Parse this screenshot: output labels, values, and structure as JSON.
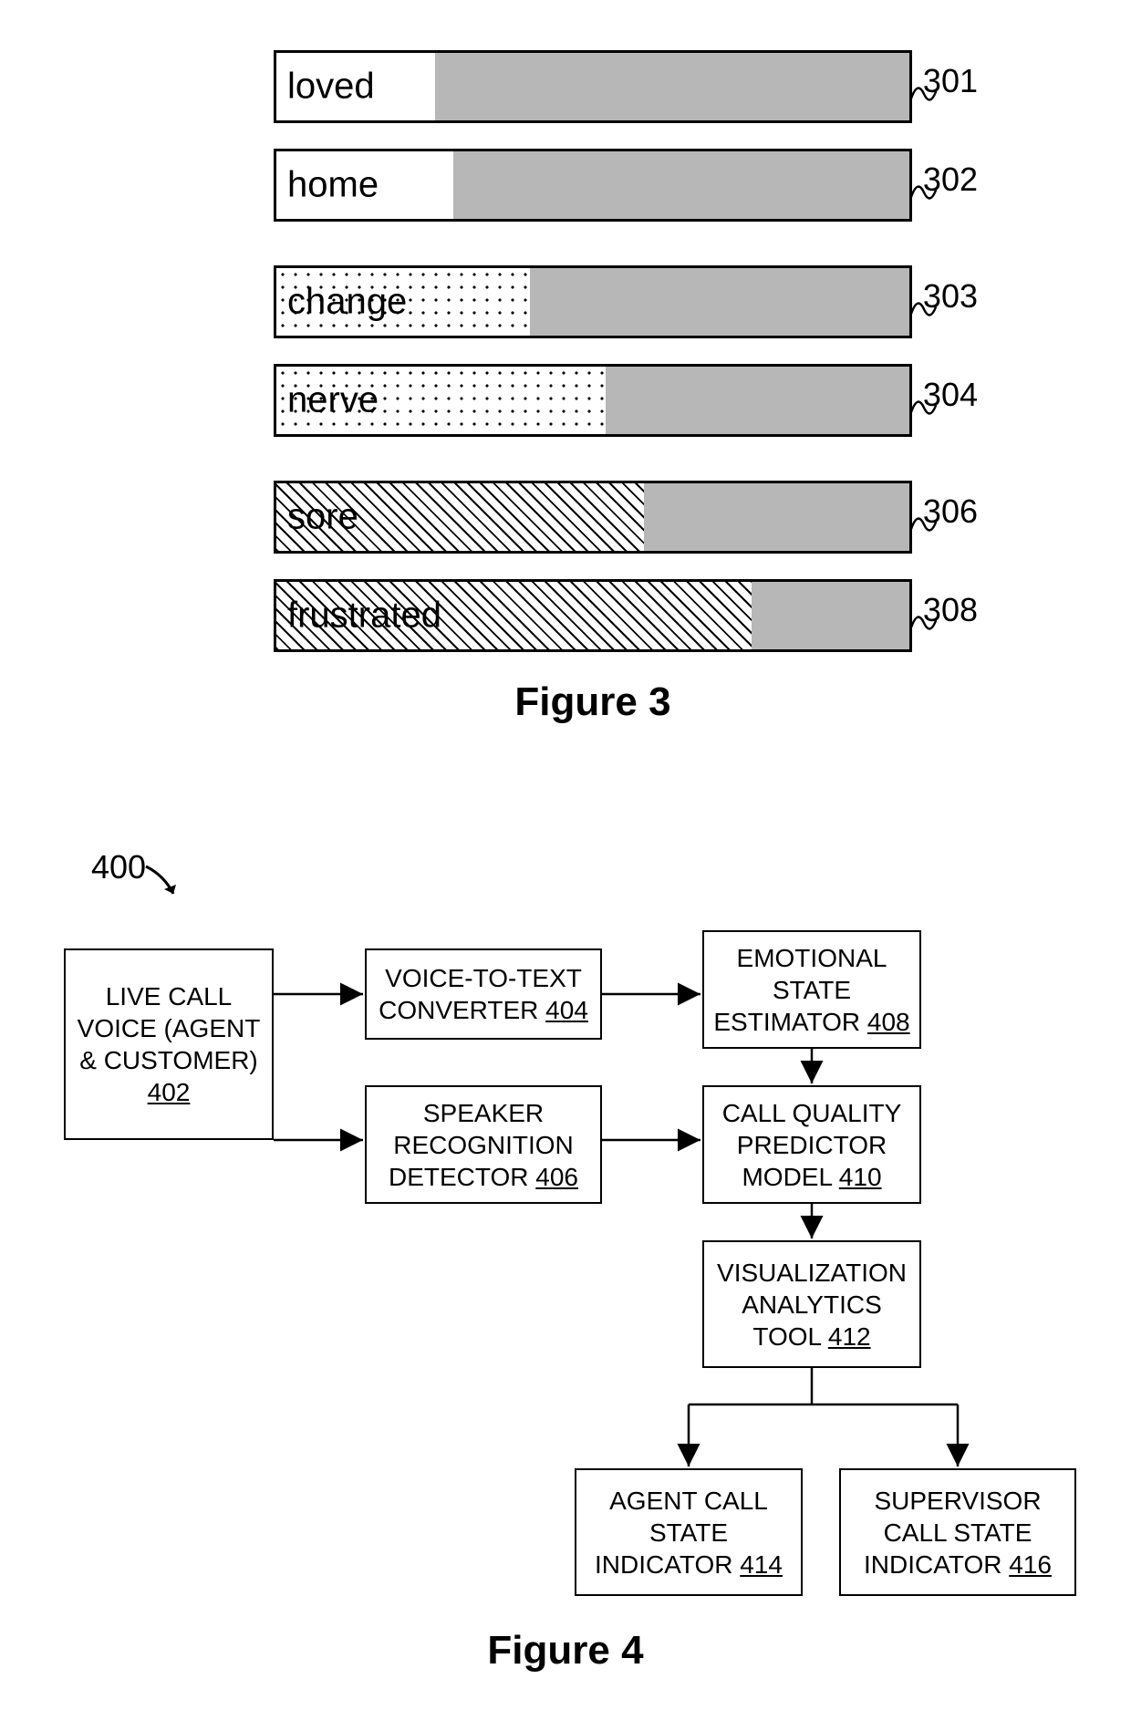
{
  "figure3": {
    "caption": "Figure 3",
    "bars": [
      {
        "label": "loved",
        "ref": "301",
        "pattern": "white",
        "fill_pct": 25
      },
      {
        "label": "home",
        "ref": "302",
        "pattern": "white",
        "fill_pct": 28
      },
      {
        "label": "change",
        "ref": "303",
        "pattern": "dots",
        "fill_pct": 40
      },
      {
        "label": "nerve",
        "ref": "304",
        "pattern": "dots",
        "fill_pct": 52
      },
      {
        "label": "sore",
        "ref": "306",
        "pattern": "hatch",
        "fill_pct": 58
      },
      {
        "label": "frustrated",
        "ref": "308",
        "pattern": "hatch",
        "fill_pct": 75
      }
    ]
  },
  "figure4": {
    "caption": "Figure 4",
    "ref": "400",
    "boxes": {
      "b402": {
        "text": "LIVE CALL VOICE (AGENT & CUSTOMER)",
        "num": "402"
      },
      "b404": {
        "text": "VOICE-TO-TEXT CONVERTER",
        "num": "404"
      },
      "b406": {
        "text": "SPEAKER RECOGNITION DETECTOR",
        "num": "406"
      },
      "b408": {
        "text": "EMOTIONAL STATE ESTIMATOR",
        "num": "408"
      },
      "b410": {
        "text": "CALL QUALITY PREDICTOR MODEL",
        "num": "410"
      },
      "b412": {
        "text": "VISUALIZATION ANALYTICS TOOL",
        "num": "412"
      },
      "b414": {
        "text": "AGENT CALL STATE INDICATOR",
        "num": "414"
      },
      "b416": {
        "text": "SUPERVISOR CALL STATE INDICATOR",
        "num": "416"
      }
    }
  }
}
